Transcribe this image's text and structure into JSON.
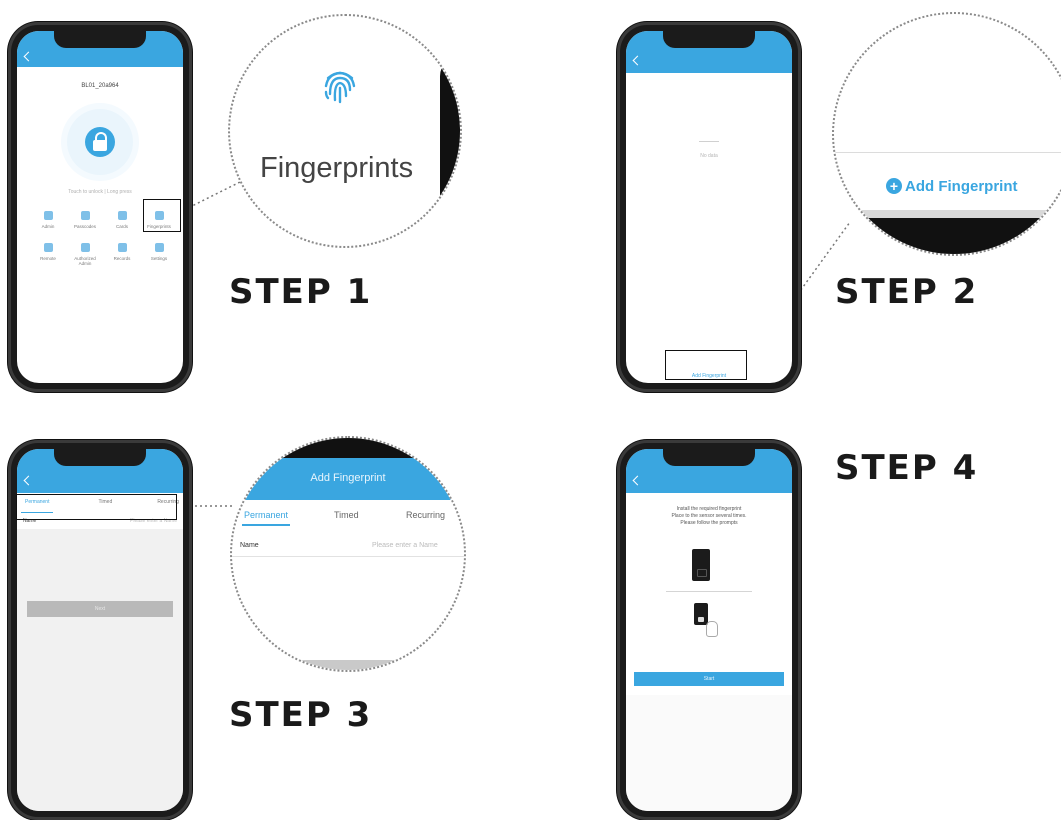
{
  "steps": [
    {
      "label": "STEP 1"
    },
    {
      "label": "STEP 2"
    },
    {
      "label": "STEP 3"
    },
    {
      "label": "STEP 4"
    }
  ],
  "step1": {
    "device_name": "BL01_20a964",
    "unlock_hint": "Touch to unlock | Long press",
    "menu_items": [
      "Admin",
      "Passcodes",
      "Cards",
      "Fingerprints",
      "Remote",
      "Authorized Admin",
      "Records",
      "Settings"
    ],
    "zoom_label": "Fingerprints"
  },
  "step2": {
    "empty_text": "No data",
    "add_button": "Add Fingerprint",
    "zoom_button": "Add Fingerprint"
  },
  "step3": {
    "title": "Add Fingerprint",
    "tabs": [
      "Permanent",
      "Timed",
      "Recurring"
    ],
    "name_label": "Name",
    "name_placeholder": "Please enter a Name",
    "next_button": "Next"
  },
  "step4": {
    "instruction_1": "Install the required fingerprint",
    "instruction_2": "Place to the sensor several times.",
    "instruction_3": "Please follow the prompts",
    "start_button": "Start"
  },
  "colors": {
    "accent": "#3aa6e0",
    "frame": "#1b1b1b"
  }
}
